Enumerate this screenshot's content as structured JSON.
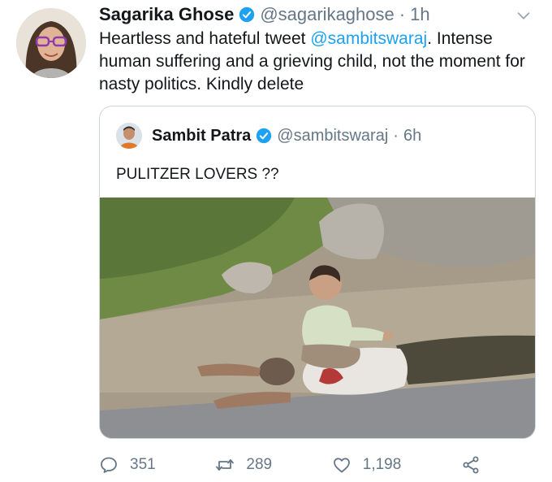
{
  "tweet": {
    "author_name": "Sagarika Ghose",
    "author_handle": "@sagarikaghose",
    "separator": "·",
    "time": "1h",
    "text_before": "Heartless and hateful tweet ",
    "mention": "@sambitswaraj",
    "text_after": ". Intense human suffering and a grieving child, not the moment for nasty politics. Kindly delete",
    "icons": {
      "avatar": "profile-photo",
      "verified": "verified-badge-icon",
      "caret": "chevron-down-icon"
    }
  },
  "quoted_tweet": {
    "author_name": "Sambit Patra",
    "author_handle": "@sambitswaraj",
    "separator": "·",
    "time": "6h",
    "text": "PULITZER LOVERS ??",
    "icons": {
      "avatar": "profile-photo",
      "verified": "verified-badge-icon"
    }
  },
  "actions": {
    "reply_count": "351",
    "retweet_count": "289",
    "like_count": "1,198",
    "icons": [
      "reply-icon",
      "retweet-icon",
      "like-icon",
      "share-icon"
    ]
  },
  "colors": {
    "link": "#1da1f2",
    "secondary_text": "#657786",
    "verified": "#1da1f2",
    "border": "#ccd6dd"
  }
}
